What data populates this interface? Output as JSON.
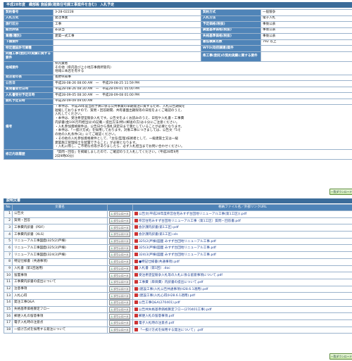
{
  "title": "平成28年度　織部殿 施設課(建築住宅課工事案件を含む)　入札予定",
  "info": {
    "r1": [
      "契約番号",
      "3-28-02228",
      "契約方式",
      "一般競争"
    ],
    "r2": [
      "入札方式",
      "発注事業",
      "入札方法",
      "電子入札"
    ],
    "r3": [
      "施行区分",
      "工事",
      "予定価格(税抜)",
      "事後公表"
    ],
    "r4": [
      "総合評価",
      "非該当",
      "調査基準価格(税抜)",
      "事後公表"
    ],
    "r5": [
      "業種(種別)",
      "建築一式工事",
      "失格基準価格(税抜)",
      "事後公表"
    ],
    "r6": [
      "下請要件",
      "",
      "最低積算点数",
      "792 以上"
    ],
    "r7": [
      "特定建設許可業種",
      "",
      "WTO(政府調達)案件",
      ""
    ],
    "r8": [
      "同種工事(委託)の実績に関する要件",
      "",
      "県工事(委託)の契約実績に関する要件",
      ""
    ],
    "area_label": "地域要件",
    "area_lines": [
      "県内業者",
      "その他（県内及び上小地方事務所管内）",
      "地域に本店を有する"
    ],
    "office_label": "発注者の長",
    "office": "長野県知事",
    "date_rows": [
      [
        "公告日",
        "平成28-08-26 08:00 AM　一　平成29-08-25 11:59 PM"
      ],
      [
        "質問書受付日時",
        "平成28-08-26 08:30 AM　一　平成28-09-01 05:00 PM"
      ],
      [
        "入札書受付予定日時",
        "平成28-09-05 08:30 AM　一　平成28-09-08 01:00 PM"
      ],
      [
        "開札予定日時",
        "平成28-09-09 09:00 AM"
      ]
    ],
    "notes_label": "備考",
    "notes": [
      "・本件は、平成28年度当初予算に係る公共事業の早期発注に資するため、入札公告期間を",
      "短縮しておりますので、質問・回答期間、共有書面出期限等の日程をよくご確認のうえ、",
      "入札してください。",
      "・本件は、受注希望型競争入札です。公告文をよくお読みのうえ、日程や入札書・工事費",
      "内訳書(金100万円相当分)の記載・提出方法(特に郵送の方)は十分にご注意ください。",
      "・入札参加資格要件は、公告日から落札決定日まで満たしていることが必要となります。",
      "・本件は、「一抜け方式」を採用しております。対象工事につきましては、公告文「5そ",
      "の他の入札条件(3)」にてご確認ください。",
      "・その他の入札参加資格要件として、「主任(監理)技術者として、一級建築士又は一級",
      "建築施工管理技士を配置できること」が必要となります。",
      "・入札に際し、ご不明な点等がありましたら、必ず入札担当までお問い合わせください。"
    ],
    "fix_label": "修正内容履歴",
    "fix_lines": [
      "「質問・回答」を掲載しましたので、ご確認のうえ入札してください。（平成28年9月",
      "2日9時00分）"
    ]
  },
  "link_button": "一覧ダウンロード",
  "docs_title": "説明文書",
  "docs_headers": [
    "No",
    "文書名",
    "",
    "格納ファイル名／外部リンクURL"
  ],
  "download_label": "ダウンロード",
  "docs": [
    {
      "no": "1",
      "name": "公告文",
      "file": "公告文(平成28年度県営住宅みすず台団地リニューアル工事(第1工区)).pdf"
    },
    {
      "no": "2",
      "name": "質問・回答",
      "file": "県営住宅みすず台団地リニューアル工事（第1工区）質問・回答書.pdf"
    },
    {
      "no": "3",
      "name": "工事費内訳書（PDF）",
      "file": "会計課内訳書(第1工区).pdf"
    },
    {
      "no": "4",
      "name": "工事費内訳書（XLS）",
      "file": "会計課内訳書(第1工区).xls"
    },
    {
      "no": "5",
      "name": "リニューアル工事図面(325(2)戸棟)",
      "file": "325(2)戸棟)図面 みすず台団地リニューアル工事.pdf"
    },
    {
      "no": "6",
      "name": "リニューアル工事図面(325(3)戸棟)",
      "file": "325(3)戸棟)図面 みすず台団地リニューアル工事.pdf"
    },
    {
      "no": "7",
      "name": "リニューアル工事図面(324(3)戸棟)",
      "file": "324(3)戸棟)図面 みすず台団地リニューアル工事.pdf"
    },
    {
      "no": "8",
      "name": "特記仕様書（共通事項）",
      "file": "●特記仕様書(共通事項).pdf"
    },
    {
      "no": "9",
      "name": "入札書（第1回送用）",
      "file": "入札書（第1回）.doc"
    },
    {
      "no": "10",
      "name": "留置事項",
      "file": "受注希望型競争入札等の入札に係る留意事項について.pdf"
    },
    {
      "no": "11",
      "name": "工事費内訳書の提出について",
      "file": "工事費（単目費）内訳書の提出について.pdf"
    },
    {
      "no": "12",
      "name": "注意事項",
      "file": "(建設工事)入札公告共通事項(H28.6.1適用).pdf"
    },
    {
      "no": "13",
      "name": "入札心得",
      "file": "(建設工事)入札心得(H28.6.1適用).pdf"
    },
    {
      "no": "14",
      "name": "発注工事Q&A",
      "file": "公告工事Q&A(270401).pdf"
    },
    {
      "no": "15",
      "name": "失格基準価格算定フロー",
      "file": "公告共失格基準価格算定フロー(270401工事).pdf"
    },
    {
      "no": "16",
      "name": "郵便入札の留意事項",
      "file": "郵便入札の留意事項.pdf"
    },
    {
      "no": "17",
      "name": "電子入札時の注意点",
      "file": "電子入札時の注意点.pdf"
    },
    {
      "no": "18",
      "name": "一抜け方式を採用する発注について",
      "file": "「一抜け方式を採用する発注について」.pdf"
    }
  ],
  "colors": {
    "header": "#3b6c9a",
    "label": "#4f84b8",
    "border": "#9bb3cc"
  }
}
